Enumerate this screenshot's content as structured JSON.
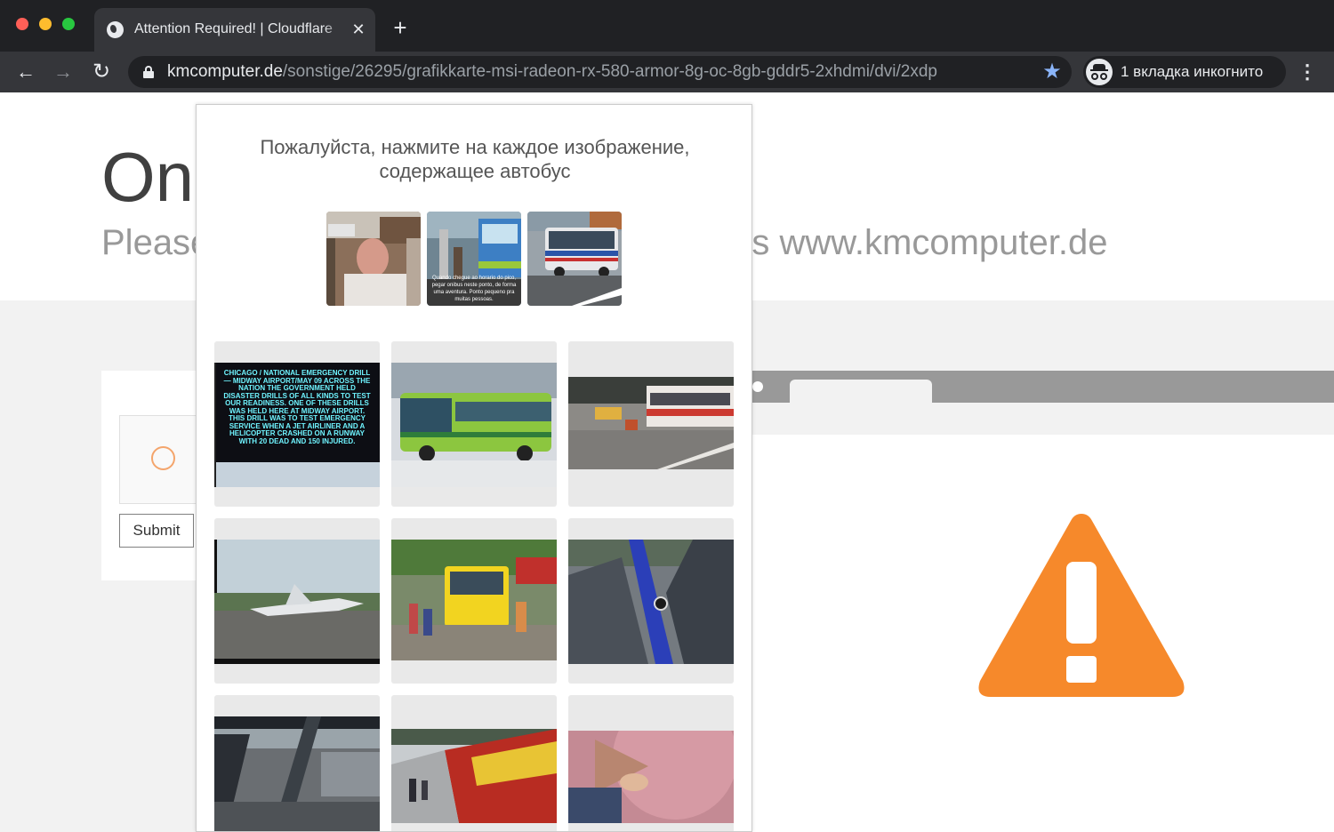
{
  "browser": {
    "tab_title": "Attention Required! | Cloudflare",
    "tab_close": "✕",
    "new_tab": "+",
    "url_host": "kmcomputer.de",
    "url_path": "/sonstige/26295/grafikkarte-msi-radeon-rx-580-armor-8g-oc-8gb-gddr5-2xhdmi/dvi/2xdp",
    "incognito_label": "1 вкладка инкогнито",
    "back": "←",
    "forward": "→",
    "reload": "↻",
    "bookmark": "★",
    "menu": "⋮"
  },
  "page": {
    "heading": "On",
    "subheading": "Please                                                   ess www.kmcomputer.de",
    "submit_label": "Submit"
  },
  "challenge": {
    "prompt": "Пожалуйста, нажмите на каждое изображение, содержащее автобус",
    "examples": [
      {
        "caption": ""
      },
      {
        "caption": "Quando chegue ao horario do pico, pegar onibus neste ponto, de forma uma aventura. Ponto pequeno pra muitas pessoas."
      },
      {
        "caption": ""
      }
    ],
    "tiles": [
      {
        "sign_text": "Chicago / National Emergency Drill — Midway airport/May 09 across the nation the government held disaster drills of all kinds to test our readiness. One of these drills was held here at Midway airport. This drill was to test emergency service when a jet airliner and a helicopter crashed on a runway with 20 dead and 150 injured."
      },
      {},
      {},
      {},
      {},
      {},
      {},
      {},
      {}
    ]
  },
  "colors": {
    "warning": "#f6892b",
    "chrome_dark": "#202124",
    "chrome_tab": "#35363a",
    "bookmark_star": "#8ab4f8"
  }
}
